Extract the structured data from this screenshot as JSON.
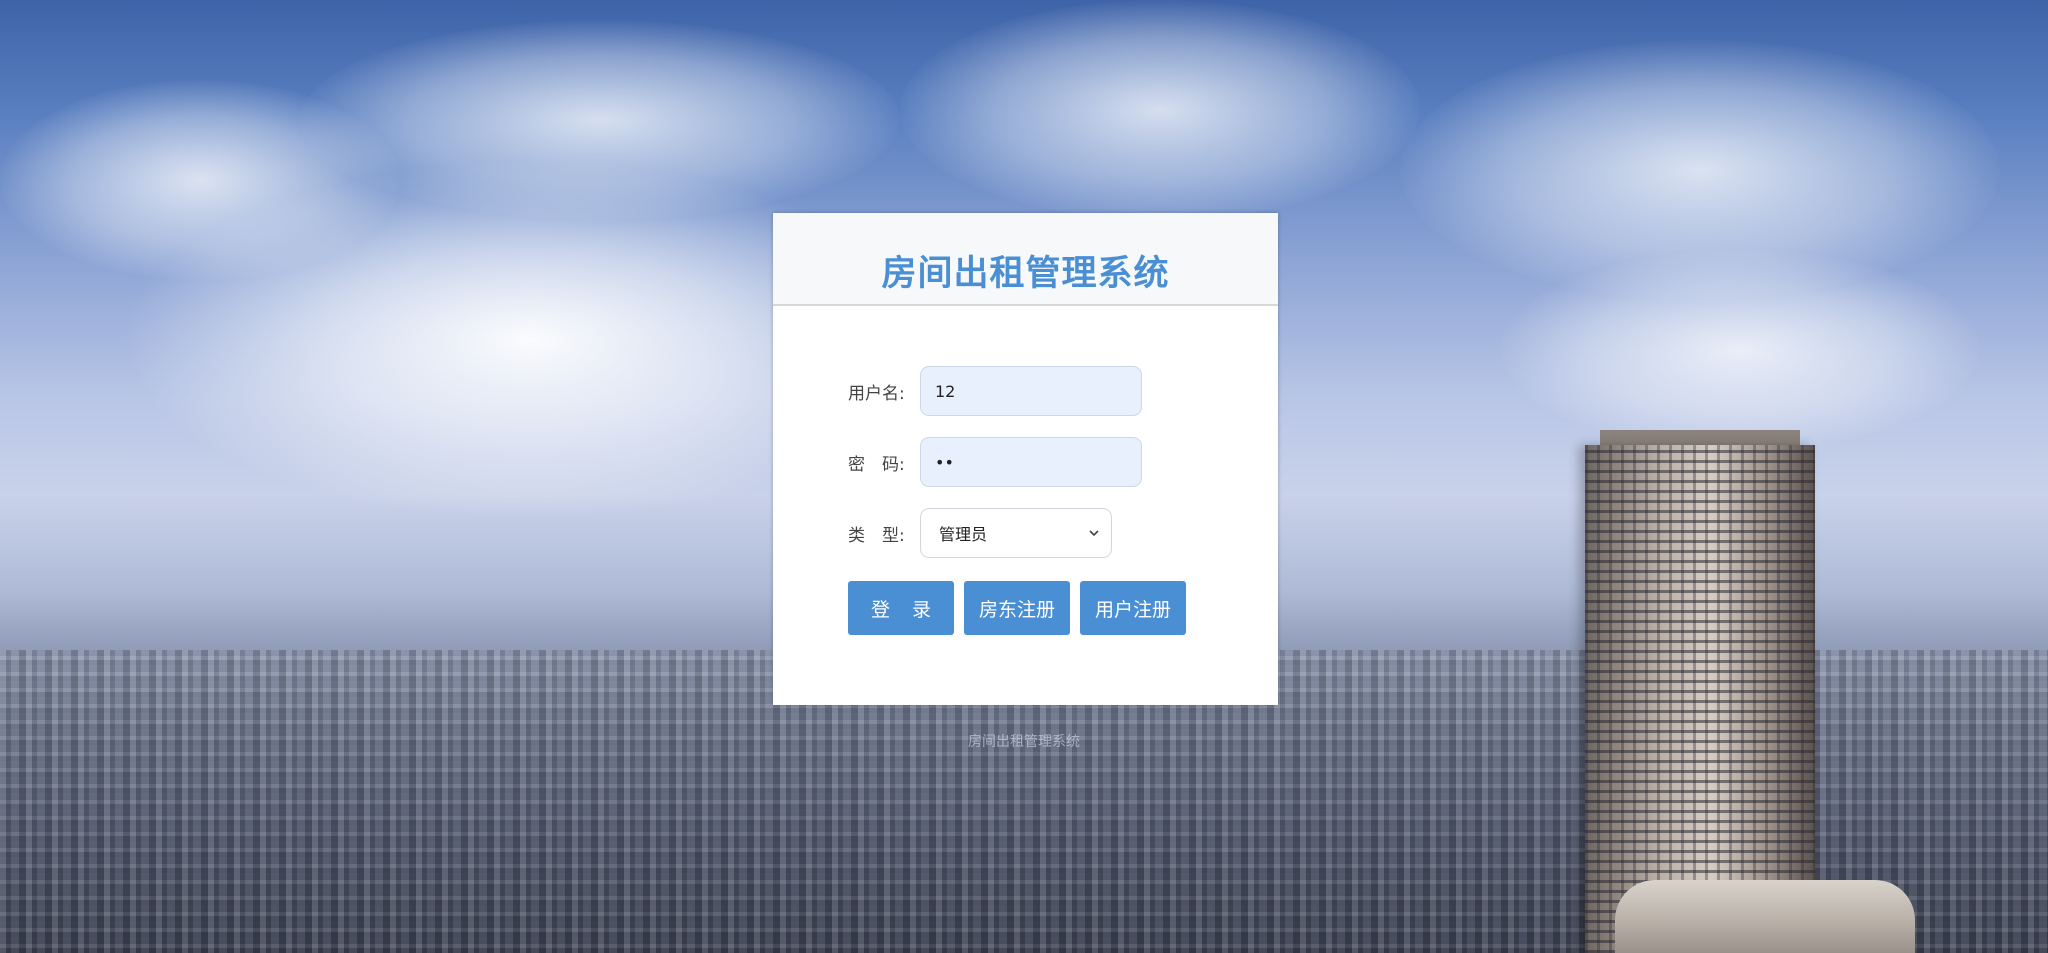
{
  "app": {
    "title": "房间出租管理系统"
  },
  "form": {
    "username_label": "用户名:",
    "username_value": "12",
    "password_label": "密　码:",
    "password_value": "••",
    "type_label": "类　型:",
    "type_selected": "管理员"
  },
  "buttons": {
    "login_label": "登 录",
    "landlord_register_label": "房东注册",
    "user_register_label": "用户注册"
  },
  "footer": {
    "text": "房间出租管理系统"
  },
  "colors": {
    "accent": "#4a8fd4",
    "input_bg": "#e8f0fe"
  },
  "icons": {
    "select_arrow": "chevron-down-icon"
  }
}
